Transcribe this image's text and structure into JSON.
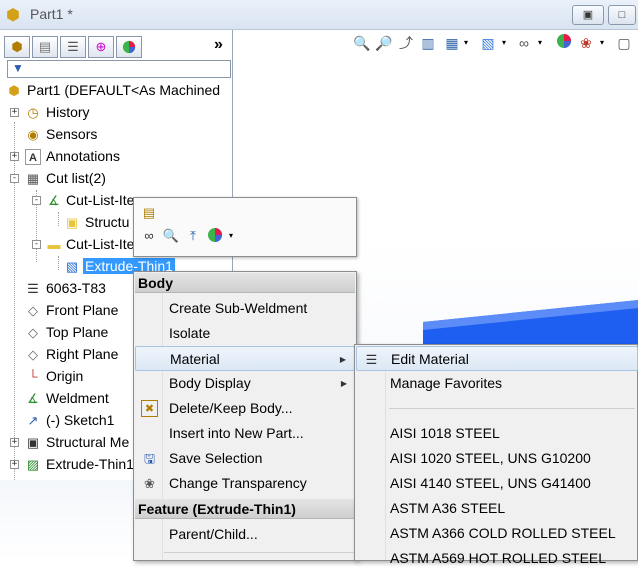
{
  "window": {
    "title": "Part1 *"
  },
  "window_buttons": [
    "restore",
    "maximize"
  ],
  "tree": {
    "root_label": "Part1  (DEFAULT<As Machined",
    "items": [
      {
        "label": "History",
        "icon": "history-icon",
        "expand": "+"
      },
      {
        "label": "Sensors",
        "icon": "sensors-icon",
        "expand": ""
      },
      {
        "label": "Annotations",
        "icon": "annotations-icon",
        "expand": "+"
      },
      {
        "label": "Cut list(2)",
        "icon": "cut-list-icon",
        "expand": "-"
      },
      {
        "label": "Cut-List-Ite",
        "icon": "cut-list-item-icon",
        "expand": "-"
      },
      {
        "label": "Structu",
        "icon": "folder-icon",
        "expand": ""
      },
      {
        "label": "Cut-List-Ite",
        "icon": "folder-icon",
        "expand": "-"
      },
      {
        "label": "Extrude-Thin1",
        "icon": "body-icon",
        "expand": ""
      },
      {
        "label": "6063-T83",
        "icon": "material-icon",
        "expand": ""
      },
      {
        "label": "Front Plane",
        "icon": "plane-icon",
        "expand": ""
      },
      {
        "label": "Top Plane",
        "icon": "plane-icon",
        "expand": ""
      },
      {
        "label": "Right Plane",
        "icon": "plane-icon",
        "expand": ""
      },
      {
        "label": "Origin",
        "icon": "origin-icon",
        "expand": ""
      },
      {
        "label": "Weldment",
        "icon": "weldment-icon",
        "expand": ""
      },
      {
        "label": "(-) Sketch1",
        "icon": "sketch-icon",
        "expand": ""
      },
      {
        "label": "Structural Me",
        "icon": "structural-member-icon",
        "expand": "+"
      },
      {
        "label": "Extrude-Thin1",
        "icon": "extrude-icon",
        "expand": "+"
      }
    ]
  },
  "context_menu": {
    "header_body": "Body",
    "items": [
      {
        "label": "Create Sub-Weldment",
        "icon": "",
        "submenu": false
      },
      {
        "label": "Isolate",
        "icon": "",
        "submenu": false
      },
      {
        "label": "Material",
        "icon": "",
        "submenu": true
      },
      {
        "label": "Body Display",
        "icon": "",
        "submenu": true
      },
      {
        "label": "Delete/Keep Body...",
        "icon": "delete-body-icon",
        "submenu": false
      },
      {
        "label": "Insert into New Part...",
        "icon": "",
        "submenu": false
      },
      {
        "label": "Save Selection",
        "icon": "save-selection-icon",
        "submenu": false
      },
      {
        "label": "Change Transparency",
        "icon": "transparency-icon",
        "submenu": false
      }
    ],
    "header_feature": "Feature (Extrude-Thin1)",
    "feature_items": [
      {
        "label": "Parent/Child..."
      }
    ]
  },
  "material_submenu": {
    "items": [
      {
        "label": "Edit Material",
        "icon": "edit-material-icon"
      },
      {
        "label": "Manage Favorites",
        "icon": ""
      },
      {
        "label": "",
        "icon": ""
      },
      {
        "label": "AISI 1018 STEEL",
        "icon": ""
      },
      {
        "label": "AISI 1020 STEEL, UNS G10200",
        "icon": ""
      },
      {
        "label": "AISI 4140 STEEL, UNS G41400",
        "icon": ""
      },
      {
        "label": "ASTM A36 STEEL",
        "icon": ""
      },
      {
        "label": "ASTM A366 COLD ROLLED STEEL",
        "icon": ""
      },
      {
        "label": "ASTM A569 HOT ROLLED STEEL",
        "icon": ""
      }
    ]
  },
  "colors": {
    "selection": "#3399ff",
    "body_blue": "#1e5ef0",
    "menu_bg": "#f0f0f0"
  }
}
